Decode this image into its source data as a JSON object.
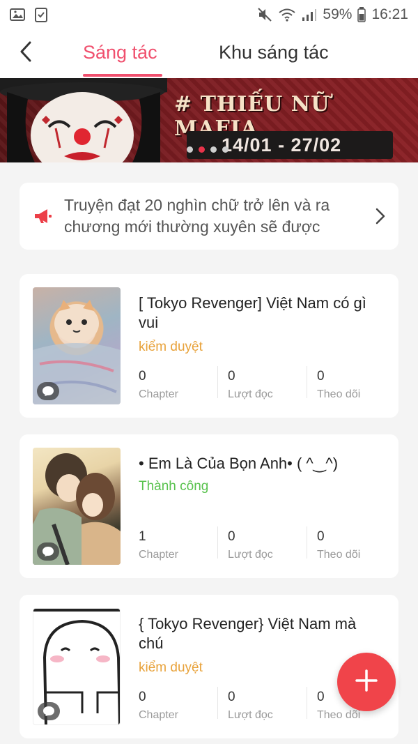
{
  "status_bar": {
    "battery_percent": "59%",
    "time": "16:21"
  },
  "nav": {
    "tabs": [
      {
        "label": "Sáng tác",
        "active": true
      },
      {
        "label": "Khu sáng tác",
        "active": false
      }
    ]
  },
  "banner": {
    "title": "# THIẾU NỮ MAFIA",
    "date_range": "14/01 - 27/02",
    "dots_total": 4,
    "dots_active_index": 1
  },
  "notice": {
    "text": "Truyện đạt 20 nghìn chữ trở lên và ra chương mới thường xuyên sẽ được"
  },
  "stories": [
    {
      "title": "[ Tokyo Revenger] Việt Nam có gì vui",
      "status": "kiểm duyệt",
      "status_color": "#e8a23a",
      "stats": [
        {
          "value": "0",
          "label": "Chapter"
        },
        {
          "value": "0",
          "label": "Lượt đọc"
        },
        {
          "value": "0",
          "label": "Theo dõi"
        }
      ]
    },
    {
      "title": "• Em Là Của Bọn Anh• ( ^‿^)",
      "status": "Thành công",
      "status_color": "#58c24d",
      "stats": [
        {
          "value": "1",
          "label": "Chapter"
        },
        {
          "value": "0",
          "label": "Lượt đọc"
        },
        {
          "value": "0",
          "label": "Theo dõi"
        }
      ]
    },
    {
      "title": "{ Tokyo Revenger} Việt Nam mà chú",
      "status": "kiểm duyệt",
      "status_color": "#e8a23a",
      "stats": [
        {
          "value": "0",
          "label": "Chapter"
        },
        {
          "value": "0",
          "label": "Lượt đọc"
        },
        {
          "value": "0",
          "label": "Theo dõi"
        }
      ]
    }
  ],
  "colors": {
    "accent": "#f0506e",
    "fab": "#f0444a"
  },
  "icons": {
    "back": "chevron-left-icon",
    "notice": "megaphone-icon",
    "notice_chevron": "chevron-right-icon",
    "comment_badge": "comment-bubble-icon",
    "fab": "plus-icon"
  }
}
